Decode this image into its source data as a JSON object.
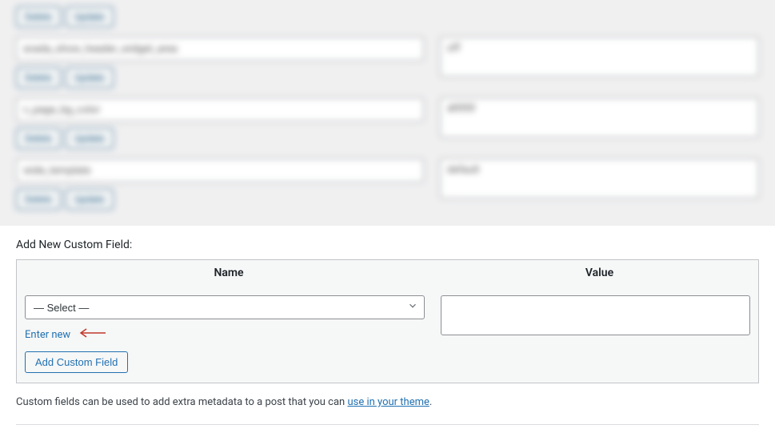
{
  "blurred": {
    "rows": [
      {
        "name": "avada_show_header_widget_area",
        "value": "off"
      },
      {
        "name": "v_page_bg_color",
        "value": "#ffffff"
      },
      {
        "name": "wide_template",
        "value": "default"
      }
    ],
    "delete_btn": "Delete",
    "update_btn": "Update"
  },
  "heading": "Add New Custom Field:",
  "table": {
    "col_name": "Name",
    "col_value": "Value"
  },
  "select": {
    "placeholder": "— Select —"
  },
  "enter_new_link": "Enter new",
  "add_btn_label": "Add Custom Field",
  "footer": {
    "text_before": "Custom fields can be used to add extra metadata to a post that you can ",
    "link_text": "use in your theme",
    "text_after": "."
  }
}
